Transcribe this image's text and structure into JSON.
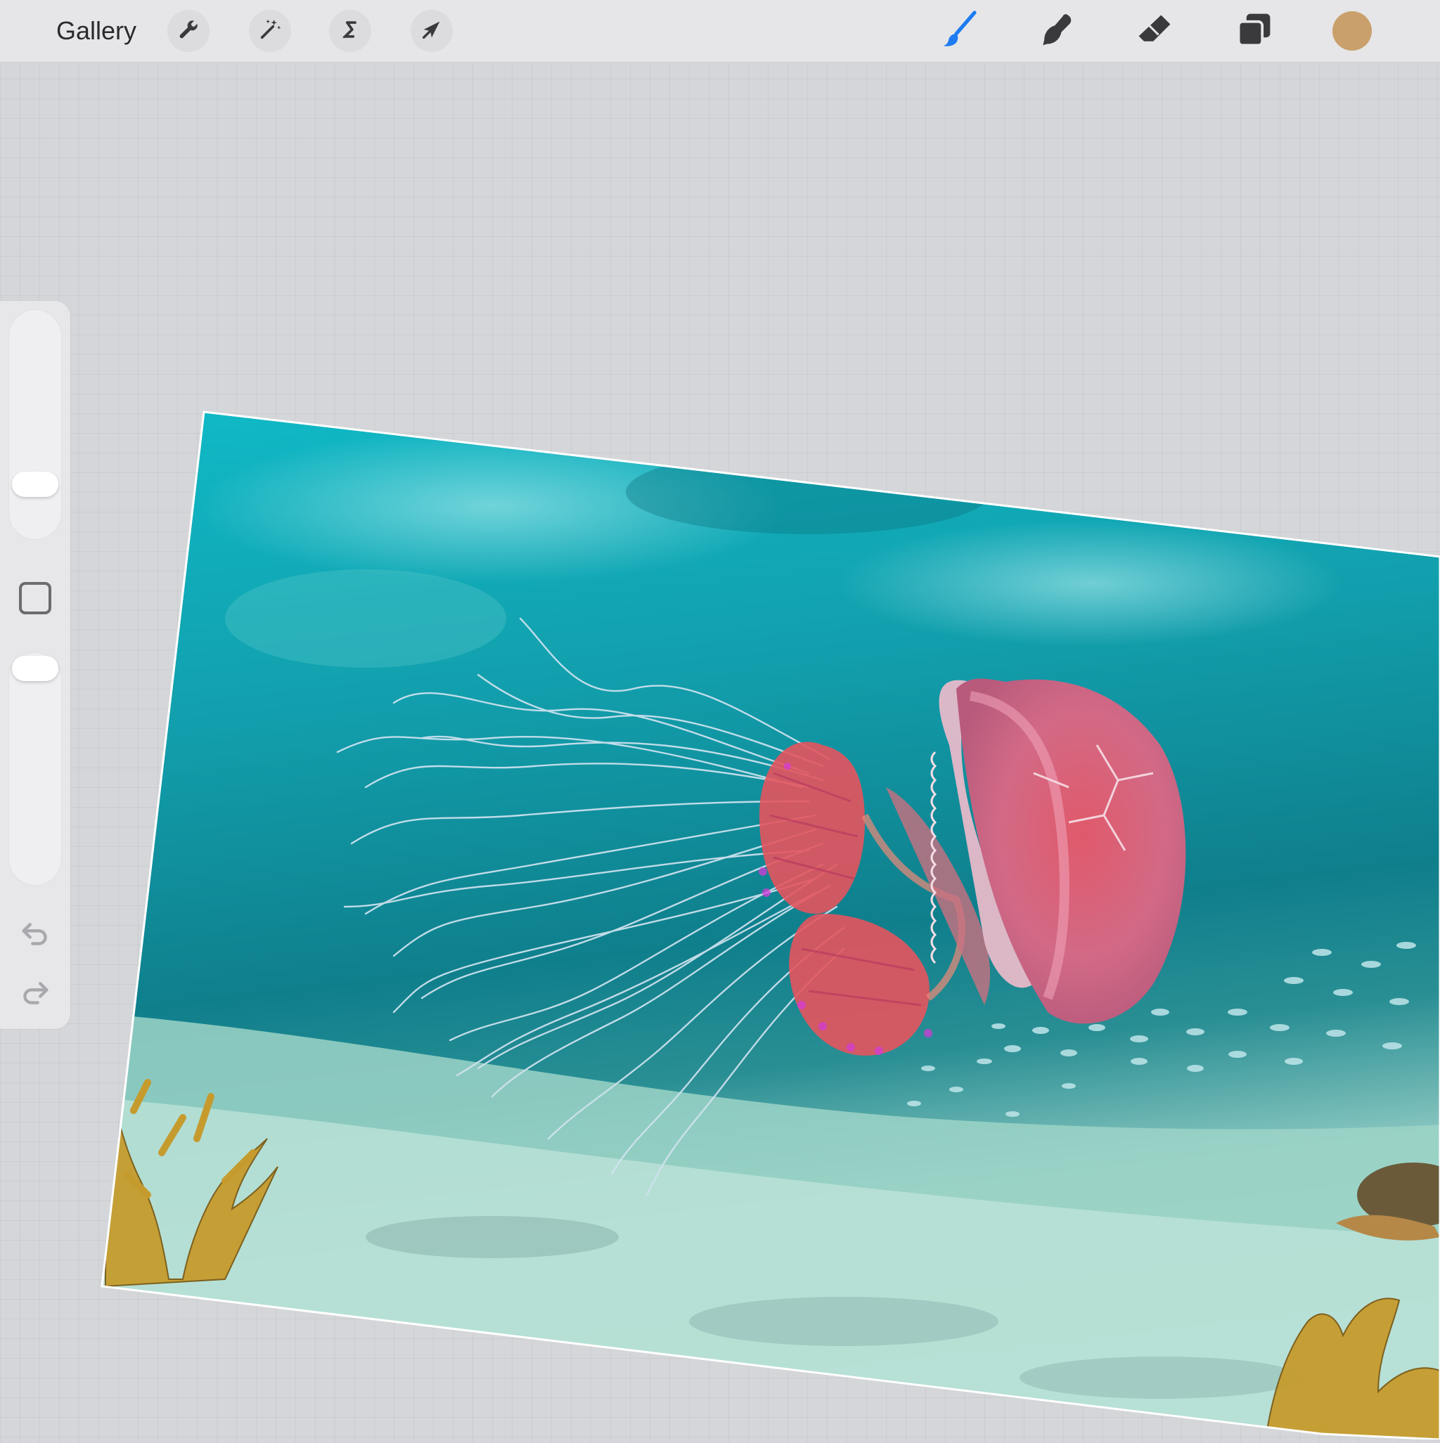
{
  "toolbar": {
    "gallery_label": "Gallery",
    "left_tools": [
      "actions-icon",
      "adjustments-icon",
      "selection-icon",
      "transform-icon"
    ],
    "right_tools": [
      "brush-icon",
      "smudge-icon",
      "eraser-icon",
      "layers-icon"
    ],
    "active_tool": "brush",
    "active_color": "#c9a06b",
    "accent_color": "#1f7cf2"
  },
  "sidebar": {
    "brush_size": 0.2,
    "opacity": 1.0,
    "modify_button": "square-icon",
    "undo": "undo-icon",
    "redo": "redo-icon"
  },
  "canvas": {
    "subject": "jellyfish",
    "rotation_deg": 7
  }
}
